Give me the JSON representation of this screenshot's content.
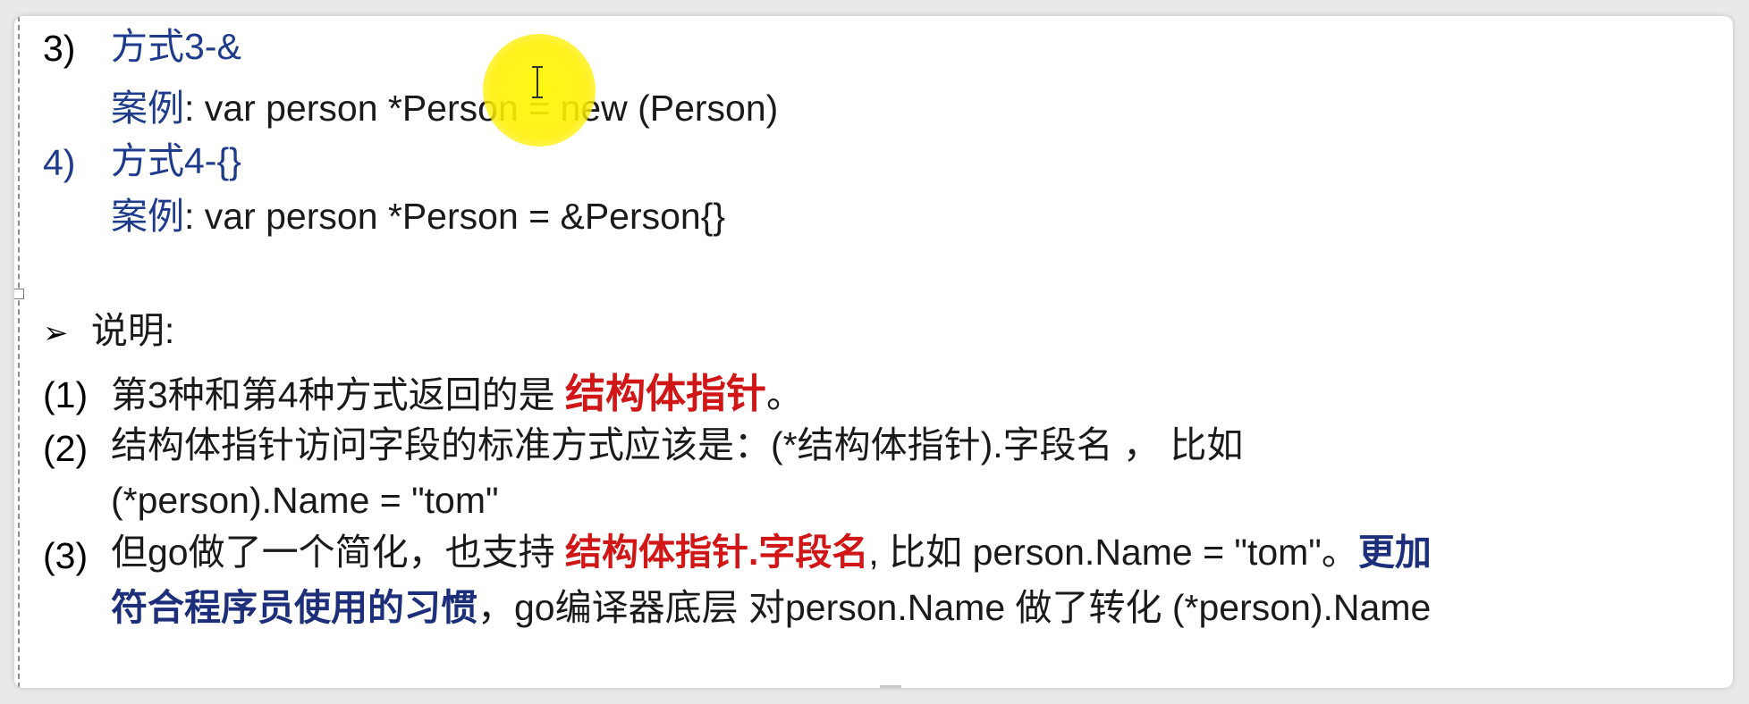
{
  "items": [
    {
      "num": "3)",
      "heading": "方式3-&",
      "example_label": "案例",
      "example_code": ": var person *Person = new (Person)"
    },
    {
      "num": "4)",
      "heading": "方式4-{}",
      "example_label": "案例",
      "example_code": ": var person *Person = &Person{}"
    }
  ],
  "note": {
    "bullet": "➢",
    "title": "说明:"
  },
  "points": [
    {
      "num": "(1)",
      "text_a": "第3种和第4种方式返回的是 ",
      "emph": "结构体指针",
      "text_b": "。"
    },
    {
      "num": "(2)",
      "line1": "结构体指针访问字段的标准方式应该是：(*结构体指针).字段名 ， 比如",
      "line2": "(*person).Name = \"tom\""
    },
    {
      "num": "(3)",
      "text_a": "但go做了一个简化，也支持 ",
      "emph": "结构体指针.字段名",
      "text_b": ", 比如 person.Name = \"tom\"。",
      "emph2_a": "更加",
      "emph2_b": "符合程序员使用的习惯",
      "text_c": "，go编译器底层 对person.Name 做了转化 (*person).Name"
    }
  ],
  "colors": {
    "blue": "#1f3c8c",
    "red": "#d01616",
    "dark_blue": "#1d2f7a",
    "text": "#1a1a1a"
  }
}
